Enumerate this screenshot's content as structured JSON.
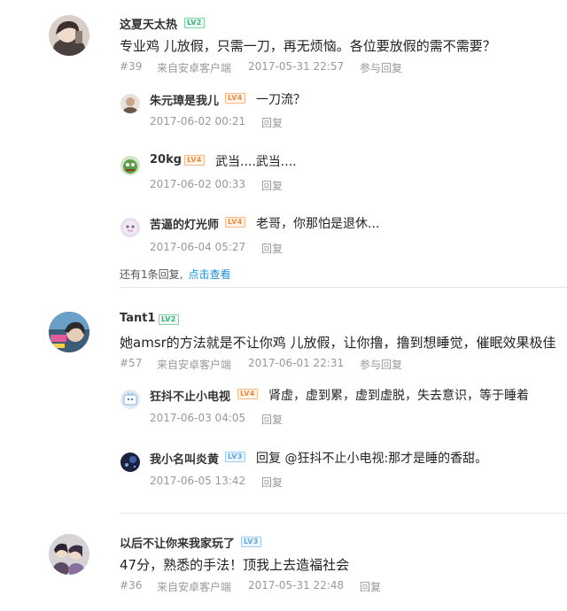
{
  "threads": [
    {
      "user": "这夏天太热",
      "level": "LV2",
      "content": "专业鸡 儿放假，只需一刀，再无烦恼。各位要放假的需不需要？",
      "floor": "#39",
      "client": "来自安卓客户端",
      "time": "2017-05-31 22:57",
      "reply_label": "参与回复",
      "replies": [
        {
          "user": "朱元璋是我儿",
          "level": "LV4",
          "text": "一刀流？",
          "time": "2017-06-02 00:21",
          "reply_label": "回复"
        },
        {
          "user": "20kg",
          "level": "LV4",
          "text": "武当....武当....",
          "time": "2017-06-02 00:33",
          "reply_label": "回复"
        },
        {
          "user": "苦逼的灯光师",
          "level": "LV4",
          "text": "老哥，你那怕是退休...",
          "time": "2017-06-04 05:27",
          "reply_label": "回复"
        }
      ],
      "more_text": "还有1条回复,",
      "more_link": "点击查看"
    },
    {
      "user": "Tant1",
      "level": "LV2",
      "content": "她amsr的方法就是不让你鸡 儿放假，让你撸，撸到想睡觉，催眠效果极佳",
      "floor": "#57",
      "client": "来自安卓客户端",
      "time": "2017-06-01 22:31",
      "reply_label": "参与回复",
      "replies": [
        {
          "user": "狂抖不止小电视",
          "level": "LV4",
          "text": "肾虚，虚到累，虚到虚脱，失去意识，等于睡着",
          "time": "2017-06-03 04:05",
          "reply_label": "回复"
        },
        {
          "user": "我小名叫炎黄",
          "level": "LV3",
          "text": "回复 @狂抖不止小电视:那才是睡的香甜。",
          "time": "2017-06-05 13:42",
          "reply_label": "回复"
        }
      ]
    },
    {
      "user": "以后不让你来我家玩了",
      "level": "LV3",
      "content": "47分，熟悉的手法！顶我上去造福社会",
      "floor": "#36",
      "client": "来自安卓客户端",
      "time": "2017-05-31 22:48",
      "reply_label": "回复"
    }
  ],
  "colors": {
    "link": "#1e8fd6",
    "meta": "#999999",
    "level_green": "#36b37e",
    "level_orange": "#f08a3c",
    "level_blue": "#5aa5e0"
  }
}
